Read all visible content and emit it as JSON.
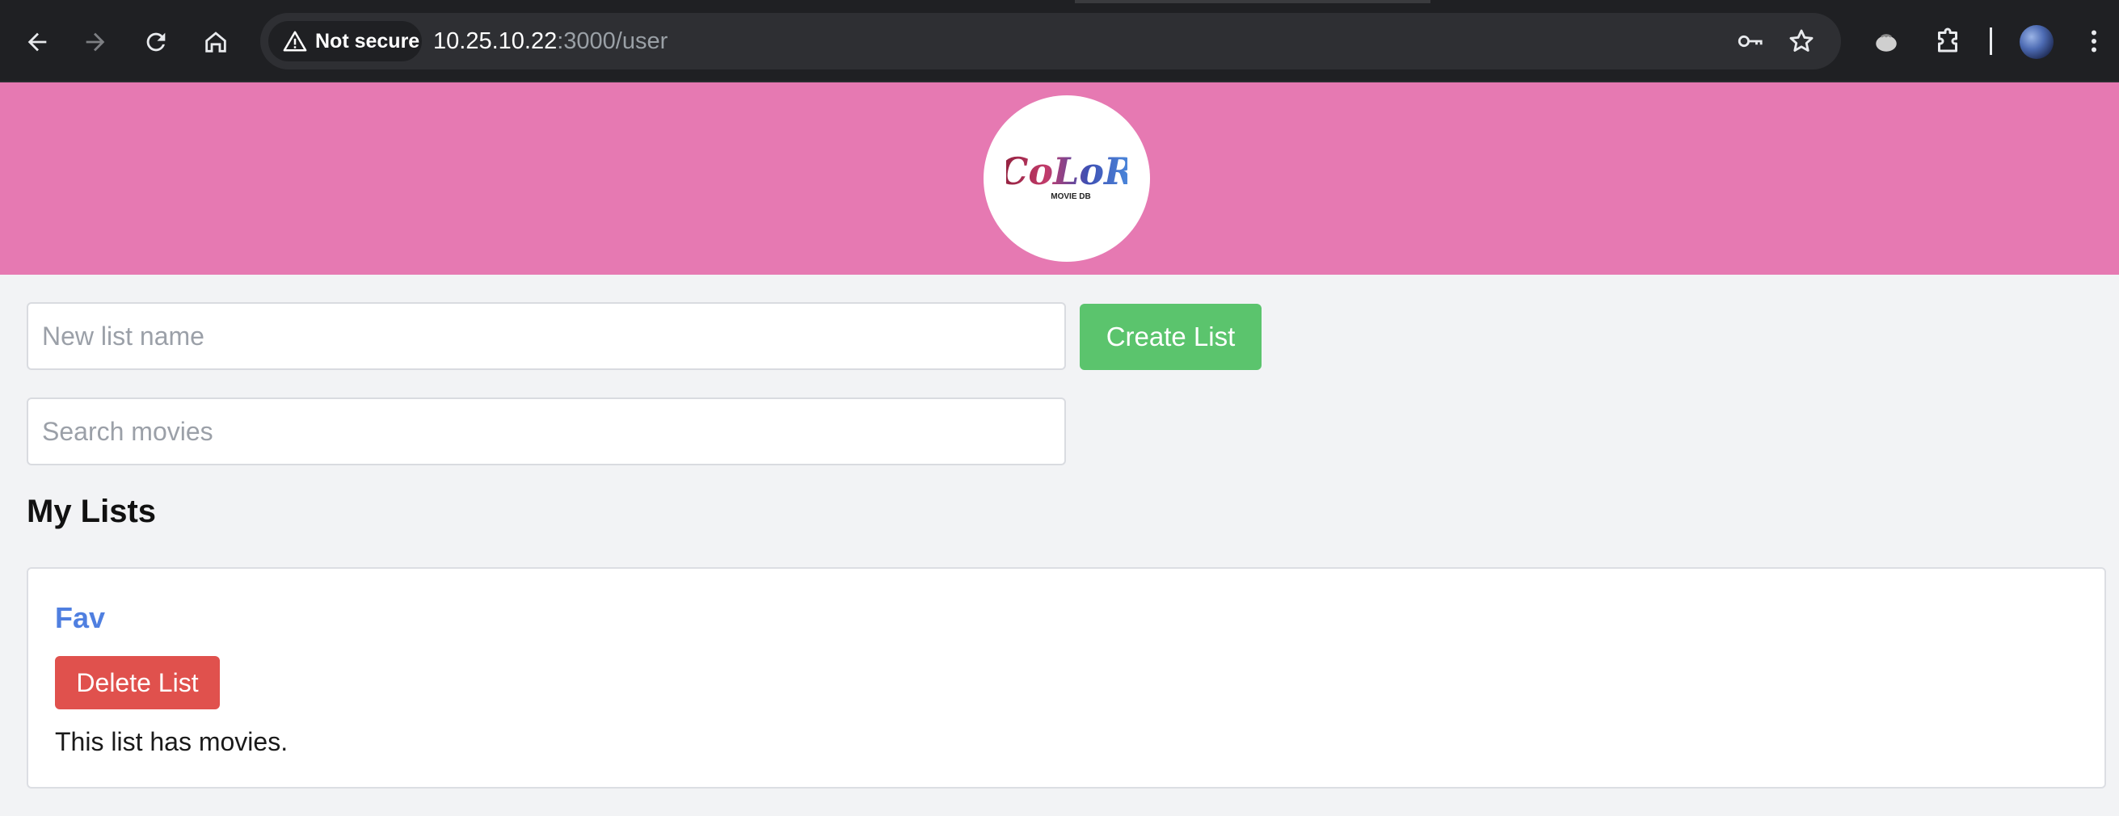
{
  "browser": {
    "security_label": "Not secure",
    "url_host": "10.25.10.22",
    "url_path": ":3000/user",
    "icons": [
      "back-icon",
      "forward-icon",
      "reload-icon",
      "home-icon",
      "warning-icon",
      "key-icon",
      "star-icon",
      "extension-puzzle-icon",
      "menu-dots-icon"
    ]
  },
  "header": {
    "logo_main": "CoLoR",
    "logo_sub": "MOVIE DB",
    "background_color": "#e679b2"
  },
  "create_form": {
    "new_list_value": "",
    "new_list_placeholder": "New list name",
    "create_label": "Create List"
  },
  "search": {
    "value": "",
    "placeholder": "Search movies"
  },
  "my_lists": {
    "title": "My Lists",
    "items": [
      {
        "name": "Fav",
        "delete_label": "Delete List",
        "status": "This list has movies."
      }
    ]
  },
  "colors": {
    "create_button": "#5bc46d",
    "delete_button": "#e0514d",
    "list_link": "#4f7fe0",
    "page_background": "#f2f3f5"
  }
}
